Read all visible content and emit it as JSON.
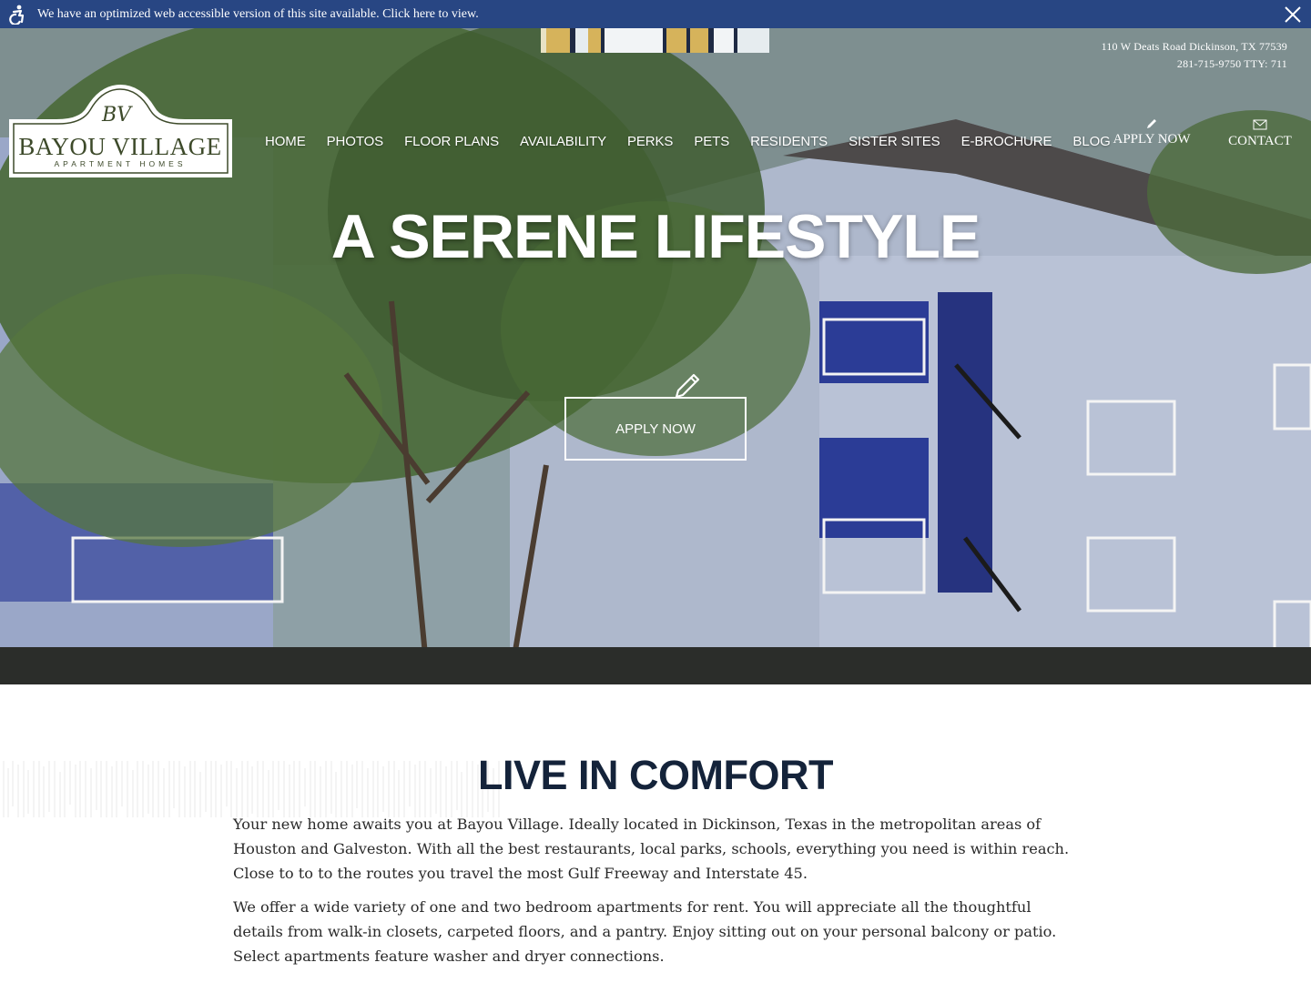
{
  "a11y_banner": {
    "text": "We have an optimized web accessible version of this site available. Click here to view."
  },
  "header": {
    "address": "110 W Deats Road Dickinson, TX 77539",
    "phone": "281-715-9750 TTY: 711",
    "logo": {
      "monogram": "BV",
      "name": "BAYOU VILLAGE",
      "tagline": "APARTMENT HOMES"
    },
    "nav": [
      "HOME",
      "PHOTOS",
      "FLOOR PLANS",
      "AVAILABILITY",
      "PERKS",
      "PETS",
      "RESIDENTS",
      "SISTER SITES",
      "E-BROCHURE",
      "BLOG"
    ],
    "apply_label": "APPLY NOW",
    "contact_label": "CONTACT"
  },
  "hero": {
    "title": "A SERENE LIFESTYLE",
    "cta_label": "APPLY NOW"
  },
  "content": {
    "title": "LIVE IN COMFORT",
    "paragraph_1": "Your new home awaits you at Bayou Village. Ideally located in Dickinson, Texas in the metropolitan areas of Houston and Galveston. With all the best restaurants, local parks, schools, everything you need is within reach. Close to to to the routes you travel the most Gulf Freeway and Interstate 45.",
    "paragraph_2": "We offer a wide variety of one and two bedroom apartments for rent. You will appreciate all the thoughtful details from walk-in closets, carpeted floors, and a pantry. Enjoy sitting out on your personal balcony or patio. Select apartments feature washer and dryer connections."
  },
  "colors": {
    "banner_bg": "#284683",
    "title_text": "#14233a",
    "logo_green": "#3d4a2a",
    "stripe_gold": "#d6b35b",
    "stripe_navy": "#1f2a44"
  },
  "icons": [
    "accessibility-icon",
    "close-icon",
    "pencil-icon",
    "envelope-icon"
  ]
}
